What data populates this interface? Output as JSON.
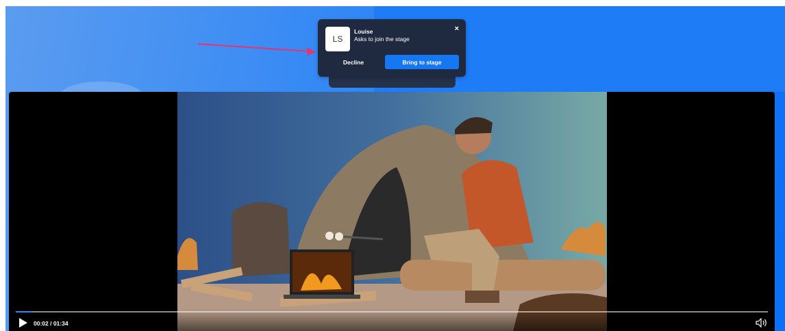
{
  "notification": {
    "avatar_initials": "LS",
    "name": "Louise",
    "message": "Asks to join the stage",
    "close_glyph": "×",
    "decline_label": "Decline",
    "bring_label": "Bring to stage"
  },
  "player": {
    "time": "00:02 / 01:34",
    "progress": 0.021,
    "play_icon": "play-icon",
    "volume_icon": "volume-icon"
  },
  "colors": {
    "accent": "#1677f2",
    "notification_bg": "#1f2a40",
    "annotation_arrow": "#e8336d"
  }
}
